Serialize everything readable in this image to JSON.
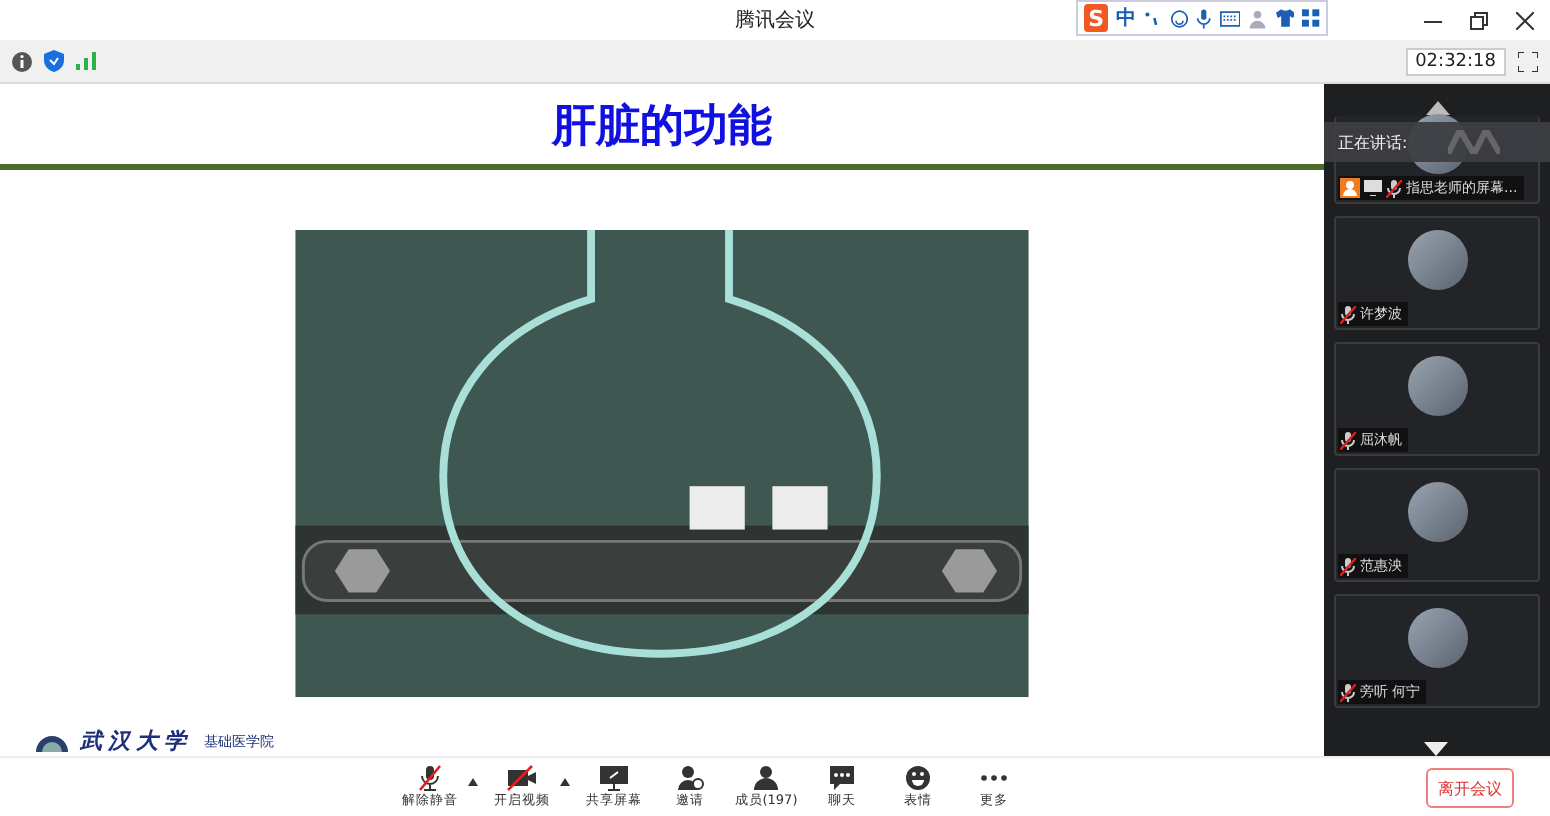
{
  "window": {
    "title": "腾讯会议"
  },
  "ime_bar": {
    "logo": "S",
    "mode": "中"
  },
  "info_bar": {
    "timer": "02:32:18"
  },
  "slide": {
    "title": "肝脏的功能",
    "logo_school": "武汉大学",
    "logo_dept": "基础医学院"
  },
  "panel": {
    "speaking_label": "正在讲话:",
    "participants": [
      {
        "name": "指思老师的屏幕...",
        "muted": true,
        "host": true,
        "sharing": true
      },
      {
        "name": "许梦波",
        "muted": true,
        "host": false,
        "sharing": false
      },
      {
        "name": "屈沐帆",
        "muted": true,
        "host": false,
        "sharing": false
      },
      {
        "name": "范惠泱",
        "muted": true,
        "host": false,
        "sharing": false
      },
      {
        "name": "旁听 何宁",
        "muted": true,
        "host": false,
        "sharing": false
      }
    ]
  },
  "toolbar": [
    {
      "kind": "mic",
      "label": "解除静音",
      "menu": true
    },
    {
      "kind": "camera",
      "label": "开启视频",
      "menu": true
    },
    {
      "kind": "share",
      "label": "共享屏幕",
      "menu": false
    },
    {
      "kind": "invite",
      "label": "邀请",
      "menu": false
    },
    {
      "kind": "members",
      "label": "成员(197)",
      "menu": false
    },
    {
      "kind": "chat",
      "label": "聊天",
      "menu": false
    },
    {
      "kind": "emoji",
      "label": "表情",
      "menu": false
    },
    {
      "kind": "more",
      "label": "更多",
      "menu": false
    }
  ],
  "leave_button": "离开会议"
}
